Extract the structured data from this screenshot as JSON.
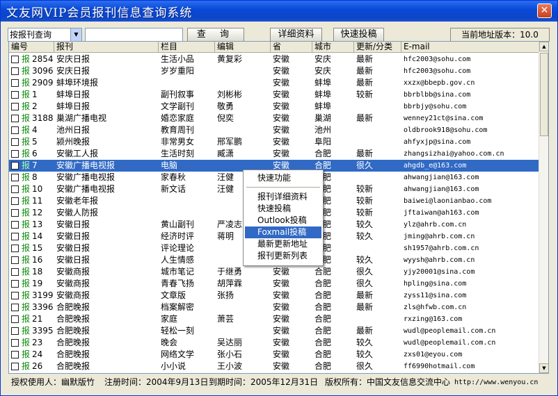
{
  "window": {
    "title": "文友网VIP会员报刊信息查询系统",
    "close_label": "✕"
  },
  "toolbar": {
    "search_type": "按报刊查询",
    "search_value": "",
    "query_label": "查 询",
    "detail_label": "详细资料",
    "submit_label": "快速投稿",
    "version_text": "当前地址版本：10.0"
  },
  "columns": [
    "编号",
    "报刊",
    "栏目",
    "编辑",
    "省",
    "城市",
    "更新/分类",
    "E-mail"
  ],
  "rows": [
    {
      "id": "2854",
      "name": "安庆日报",
      "col": "生活小品",
      "editor": "黄复彩",
      "prov": "安徽",
      "city": "安庆",
      "upd": "最新",
      "mail": "hfc2003@sohu.com"
    },
    {
      "id": "3096",
      "name": "安庆日报",
      "col": "岁岁重阳",
      "editor": "",
      "prov": "安徽",
      "city": "安庆",
      "upd": "最新",
      "mail": "hfc2003@sohu.com"
    },
    {
      "id": "2909",
      "name": "蚌埠环境报",
      "col": "",
      "editor": "",
      "prov": "安徽",
      "city": "蚌埠",
      "upd": "最新",
      "mail": "xxzx@bbepb.gov.cn"
    },
    {
      "id": "1",
      "name": "蚌埠日报",
      "col": "副刊叙事",
      "editor": "刘彬彬",
      "prov": "安徽",
      "city": "蚌埠",
      "upd": "较新",
      "mail": "bbrblbb@sina.com"
    },
    {
      "id": "2",
      "name": "蚌埠日报",
      "col": "文学副刊",
      "editor": "敬勇",
      "prov": "安徽",
      "city": "蚌埠",
      "upd": "",
      "mail": "bbrbjy@sohu.com"
    },
    {
      "id": "3188",
      "name": "巢湖广播电视",
      "col": "婚恋家庭",
      "editor": "倪奕",
      "prov": "安徽",
      "city": "巢湖",
      "upd": "最新",
      "mail": "wenney21ct@sina.com"
    },
    {
      "id": "4",
      "name": "池州日报",
      "col": "教育周刊",
      "editor": "",
      "prov": "安徽",
      "city": "池州",
      "upd": "",
      "mail": "oldbrook918@sohu.com"
    },
    {
      "id": "5",
      "name": "颍州晚报",
      "col": "非常男女",
      "editor": "邢军鹏",
      "prov": "安徽",
      "city": "阜阳",
      "upd": "",
      "mail": "ahfyxjp@sina.com"
    },
    {
      "id": "6",
      "name": "安徽工人报",
      "col": "生活时刻",
      "editor": "臧潇",
      "prov": "安徽",
      "city": "合肥",
      "upd": "最新",
      "mail": "zhangsizhai@yahoo.com.cn"
    },
    {
      "id": "7",
      "name": "安徽广播电视报",
      "col": "电脑",
      "editor": "",
      "prov": "安徽",
      "city": "合肥",
      "upd": "很久",
      "mail": "ahgdb_e@163.com",
      "selected": true
    },
    {
      "id": "8",
      "name": "安徽广播电视报",
      "col": "家春秋",
      "editor": "汪健",
      "prov": "安徽",
      "city": "合肥",
      "upd": "",
      "mail": "ahwangjian@163.com"
    },
    {
      "id": "10",
      "name": "安徽广播电视报",
      "col": "新文话",
      "editor": "汪健",
      "prov": "安徽",
      "city": "合肥",
      "upd": "较新",
      "mail": "ahwangjian@163.com"
    },
    {
      "id": "11",
      "name": "安徽老年报",
      "col": "",
      "editor": "",
      "prov": "安徽",
      "city": "合肥",
      "upd": "较新",
      "mail": "baiwei@laonianbao.com"
    },
    {
      "id": "12",
      "name": "安徽人防报",
      "col": "",
      "editor": "",
      "prov": "安徽",
      "city": "合肥",
      "upd": "较新",
      "mail": "jftaiwan@ah163.com"
    },
    {
      "id": "13",
      "name": "安徽日报",
      "col": "黄山副刊",
      "editor": "严凌志",
      "prov": "安徽",
      "city": "合肥",
      "upd": "较久",
      "mail": "ylz@ahrb.com.cn"
    },
    {
      "id": "14",
      "name": "安徽日报",
      "col": "经济时评",
      "editor": "蒋明",
      "prov": "安徽",
      "city": "合肥",
      "upd": "较久",
      "mail": "jming@ahrb.com.cn"
    },
    {
      "id": "15",
      "name": "安徽日报",
      "col": "评论理论",
      "editor": "",
      "prov": "安徽",
      "city": "合肥",
      "upd": "",
      "mail": "sh1957@ahrb.com.cn"
    },
    {
      "id": "16",
      "name": "安徽日报",
      "col": "人生情感",
      "editor": "",
      "prov": "安徽",
      "city": "合肥",
      "upd": "较久",
      "mail": "wyysh@ahrb.com.cn"
    },
    {
      "id": "18",
      "name": "安徽商报",
      "col": "城市笔记",
      "editor": "于继勇",
      "prov": "安徽",
      "city": "合肥",
      "upd": "很久",
      "mail": "yjy20001@sina.com"
    },
    {
      "id": "19",
      "name": "安徽商报",
      "col": "青春飞扬",
      "editor": "胡萍霖",
      "prov": "安徽",
      "city": "合肥",
      "upd": "很久",
      "mail": "hpling@sina.com"
    },
    {
      "id": "3199",
      "name": "安徽商报",
      "col": "文章版",
      "editor": "张扬",
      "prov": "安徽",
      "city": "合肥",
      "upd": "最新",
      "mail": "zyss11@sina.com"
    },
    {
      "id": "3396",
      "name": "合肥晚报",
      "col": "档案解密",
      "editor": "",
      "prov": "安徽",
      "city": "合肥",
      "upd": "最新",
      "mail": "zls@hfwb.com.cn"
    },
    {
      "id": "21",
      "name": "合肥晚报",
      "col": "家庭",
      "editor": "萧芸",
      "prov": "安徽",
      "city": "合肥",
      "upd": "",
      "mail": "rxzing@163.com"
    },
    {
      "id": "3395",
      "name": "合肥晚报",
      "col": "轻松一刻",
      "editor": "",
      "prov": "安徽",
      "city": "合肥",
      "upd": "最新",
      "mail": "wudl@peoplemail.com.cn"
    },
    {
      "id": "23",
      "name": "合肥晚报",
      "col": "晚会",
      "editor": "吴达丽",
      "prov": "安徽",
      "city": "合肥",
      "upd": "较久",
      "mail": "wudl@peoplemail.com.cn"
    },
    {
      "id": "24",
      "name": "合肥晚报",
      "col": "网络文学",
      "editor": "张小石",
      "prov": "安徽",
      "city": "合肥",
      "upd": "较久",
      "mail": "zxs01@eyou.com"
    },
    {
      "id": "26",
      "name": "合肥晚报",
      "col": "小小说",
      "editor": "王小波",
      "prov": "安徽",
      "city": "合肥",
      "upd": "很久",
      "mail": "ff6990hotmail.com"
    },
    {
      "id": "",
      "name": "",
      "col": "",
      "editor": "",
      "prov": "",
      "city": "",
      "upd": "",
      "mail": ""
    }
  ],
  "row_mark": "报",
  "context_menu": {
    "items": [
      "快速功能",
      "报刊详细资料",
      "快速投稿",
      "Outlook投稿",
      "Foxmail投稿",
      "最新更新地址",
      "报刊更新列表"
    ],
    "active": "Foxmail投稿"
  },
  "status": {
    "user": "授权使用人：幽默版竹",
    "reg_time": "注册时间：2004年9月13日",
    "expire_time": "到期时间：2005年12月31日",
    "copyright": "版权所有：中国文友信息交流中心",
    "url": "http://www.wenyou.cn"
  },
  "colors": {
    "title_bar": "#0a4ad8",
    "selection": "#316ac5",
    "mark_green": "#0a8a0a"
  }
}
